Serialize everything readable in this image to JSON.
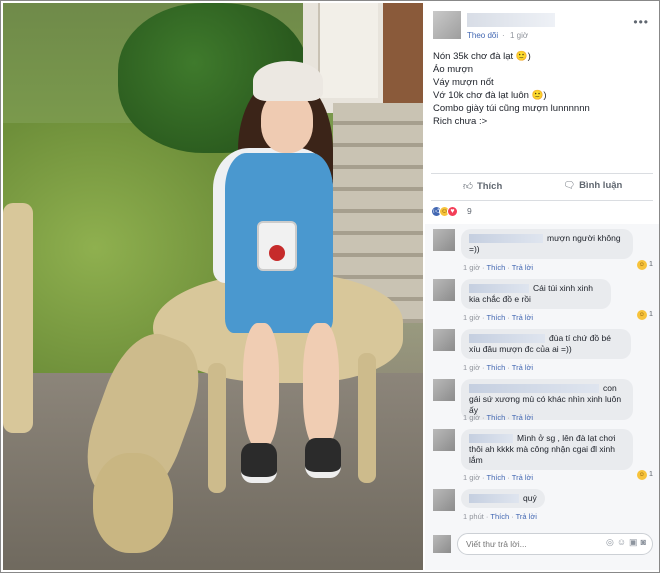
{
  "post": {
    "follow_label": "Theo dõi",
    "separator": "·",
    "time": "1 giờ",
    "more_icon": "more-horizontal-icon",
    "caption_lines": [
      "Nón 35k chơ đà lạt 🙂)",
      "Áo mượn",
      "Váy mượn nốt",
      "Vớ 10k chơ đà lạt luôn 🙂)",
      "Combo giày túi cũng mượn lunnnnnn",
      "Rich chưa :>"
    ]
  },
  "actions": {
    "like_label": "Thích",
    "like_icon": "thumbs-up-icon",
    "comment_label": "Bình luận",
    "comment_icon": "speech-bubble-icon"
  },
  "reactions": {
    "count": "9",
    "types": [
      "like",
      "haha",
      "love"
    ]
  },
  "comments": [
    {
      "text": "mượn người không =))",
      "time": "1 giờ",
      "like": "Thích",
      "reply": "Trả lời",
      "reacts": "1"
    },
    {
      "text": "Cái túi xinh xinh kia chắc đồ e rồi",
      "time": "1 giờ",
      "like": "Thích",
      "reply": "Trả lời",
      "reacts": "1"
    },
    {
      "text": "đùa tí chứ đồ bé xíu đâu mượn đc của ai =))",
      "time": "1 giờ",
      "like": "Thích",
      "reply": "Trả lời",
      "reacts": ""
    },
    {
      "text": "con gái sứ xương mù có khác nhìn xinh luôn ấy",
      "time": "1 giờ",
      "like": "Thích",
      "reply": "Trả lời",
      "reacts": ""
    },
    {
      "text": "Mình ở sg , lên đà lạt chơi thôi ah kkkk mà công nhận cgai đl xinh lắm",
      "time": "1 giờ",
      "like": "Thích",
      "reply": "Trả lời",
      "reacts": "1"
    },
    {
      "text": "quý",
      "time": "1 phút",
      "like": "Thích",
      "reply": "Trả lời",
      "reacts": ""
    }
  ],
  "write_comment": {
    "placeholder": "Viết thư trả lời...",
    "icons": [
      "camera-icon",
      "emoji-icon",
      "gif-icon",
      "sticker-icon"
    ]
  }
}
